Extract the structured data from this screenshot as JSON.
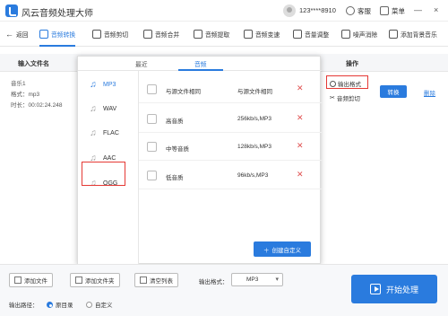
{
  "app": {
    "title": "风云音频处理大师"
  },
  "titlebar": {
    "user": "123****8910",
    "service": "客服",
    "menu": "菜单",
    "minimize": "—",
    "close": "×"
  },
  "toolbar": {
    "back": "返回",
    "items": [
      "音频转换",
      "音频剪切",
      "音频合并",
      "音频提取",
      "音频变速",
      "音量调整",
      "噪声消除",
      "添加背景音乐"
    ],
    "active_index": 0
  },
  "table": {
    "columns": [
      "输入文件名",
      "操作"
    ],
    "file": {
      "name": "音乐1",
      "format": "格式：mp3",
      "duration": "时长：00:02:24.248"
    },
    "ops": {
      "output_format": "输出格式",
      "audio_cut": "音频剪切",
      "convert": "转换",
      "delete": "删除"
    }
  },
  "popup": {
    "tabs": [
      "最近",
      "音频"
    ],
    "active_tab": 1,
    "formats": [
      "MP3",
      "WAV",
      "FLAC",
      "AAC",
      "OGG"
    ],
    "active_format": 0,
    "qualities": [
      {
        "name": "与源文件相同",
        "value": "与源文件相同"
      },
      {
        "name": "高音质",
        "value": "256kb/s,MP3"
      },
      {
        "name": "中等音质",
        "value": "128kb/s,MP3"
      },
      {
        "name": "低音质",
        "value": "96kb/s,MP3"
      }
    ],
    "create_custom": "创建自定义"
  },
  "bottom": {
    "add_file": "添加文件",
    "add_folder": "添加文件夹",
    "clear_list": "清空列表",
    "output_format_label": "输出格式：",
    "output_format_value": "MP3",
    "output_path_label": "输出路径：",
    "path_options": [
      "原目录",
      "自定义"
    ],
    "path_selected": 0,
    "start": "开始处理"
  },
  "colors": {
    "accent": "#2a7bde",
    "highlight": "#e53935",
    "delete_x": "#e05050"
  }
}
